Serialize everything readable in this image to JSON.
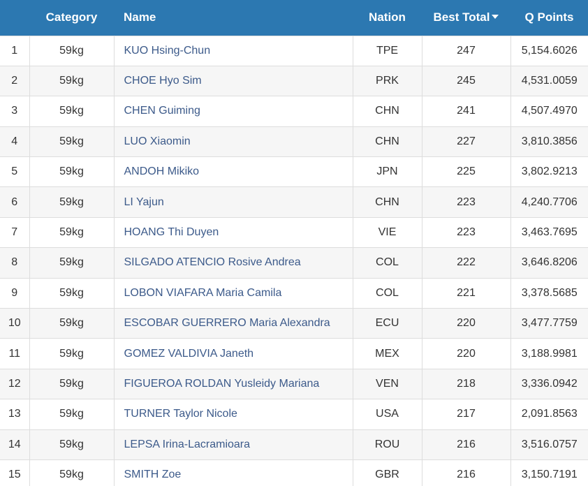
{
  "header": {
    "rank": "",
    "category": "Category",
    "name": "Name",
    "nation": "Nation",
    "best_total": "Best Total",
    "q_points": "Q Points",
    "sort_icon": "caret-down-icon"
  },
  "colors": {
    "header_bg": "#2c78b1",
    "name_link": "#3c5a8a",
    "row_alt": "#f6f6f6"
  },
  "rows": [
    {
      "rank": "1",
      "category": "59kg",
      "name": "KUO Hsing-Chun",
      "nation": "TPE",
      "best_total": "247",
      "q_points": "5,154.6026"
    },
    {
      "rank": "2",
      "category": "59kg",
      "name": "CHOE Hyo Sim",
      "nation": "PRK",
      "best_total": "245",
      "q_points": "4,531.0059"
    },
    {
      "rank": "3",
      "category": "59kg",
      "name": "CHEN Guiming",
      "nation": "CHN",
      "best_total": "241",
      "q_points": "4,507.4970"
    },
    {
      "rank": "4",
      "category": "59kg",
      "name": "LUO Xiaomin",
      "nation": "CHN",
      "best_total": "227",
      "q_points": "3,810.3856"
    },
    {
      "rank": "5",
      "category": "59kg",
      "name": "ANDOH Mikiko",
      "nation": "JPN",
      "best_total": "225",
      "q_points": "3,802.9213"
    },
    {
      "rank": "6",
      "category": "59kg",
      "name": "LI Yajun",
      "nation": "CHN",
      "best_total": "223",
      "q_points": "4,240.7706"
    },
    {
      "rank": "7",
      "category": "59kg",
      "name": "HOANG Thi Duyen",
      "nation": "VIE",
      "best_total": "223",
      "q_points": "3,463.7695"
    },
    {
      "rank": "8",
      "category": "59kg",
      "name": "SILGADO ATENCIO Rosive Andrea",
      "nation": "COL",
      "best_total": "222",
      "q_points": "3,646.8206"
    },
    {
      "rank": "9",
      "category": "59kg",
      "name": "LOBON VIAFARA Maria Camila",
      "nation": "COL",
      "best_total": "221",
      "q_points": "3,378.5685"
    },
    {
      "rank": "10",
      "category": "59kg",
      "name": "ESCOBAR GUERRERO Maria Alexandra",
      "nation": "ECU",
      "best_total": "220",
      "q_points": "3,477.7759"
    },
    {
      "rank": "11",
      "category": "59kg",
      "name": "GOMEZ VALDIVIA Janeth",
      "nation": "MEX",
      "best_total": "220",
      "q_points": "3,188.9981"
    },
    {
      "rank": "12",
      "category": "59kg",
      "name": "FIGUEROA ROLDAN Yusleidy Mariana",
      "nation": "VEN",
      "best_total": "218",
      "q_points": "3,336.0942"
    },
    {
      "rank": "13",
      "category": "59kg",
      "name": "TURNER Taylor Nicole",
      "nation": "USA",
      "best_total": "217",
      "q_points": "2,091.8563"
    },
    {
      "rank": "14",
      "category": "59kg",
      "name": "LEPSA Irina-Lacramioara",
      "nation": "ROU",
      "best_total": "216",
      "q_points": "3,516.0757"
    },
    {
      "rank": "15",
      "category": "59kg",
      "name": "SMITH Zoe",
      "nation": "GBR",
      "best_total": "216",
      "q_points": "3,150.7191"
    }
  ]
}
